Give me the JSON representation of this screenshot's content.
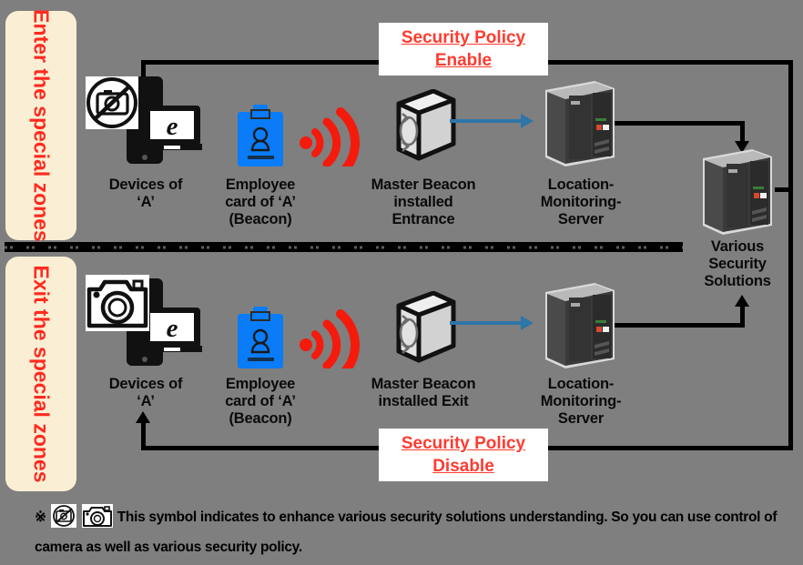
{
  "diagram": {
    "background_color": "#7f7f7f",
    "accent_red": "#ff3b30",
    "zone_box_color": "#faefd4",
    "blue_arrow_color": "#2e75a8",
    "badge_color": "#0a7cf7"
  },
  "zones": {
    "enter": {
      "label": "Enter the special zones"
    },
    "exit": {
      "label": "Exit the special zones"
    }
  },
  "policies": {
    "enable": {
      "label": "Security Policy\nEnable"
    },
    "disable": {
      "label": "Security Policy\nDisable"
    }
  },
  "top_row": {
    "devices": {
      "label": "Devices of\n‘A’",
      "icon": "no-camera-phone-laptop-icon"
    },
    "card": {
      "label": "Employee\ncard of ‘A’\n(Beacon)",
      "icon": "employee-badge-icon"
    },
    "signal": {
      "icon": "beacon-signal-icon"
    },
    "beacon": {
      "label": "Master Beacon\ninstalled\nEntrance",
      "icon": "beacon-device-icon"
    },
    "server": {
      "label": "Location-\nMonitoring-\nServer",
      "icon": "server-tower-icon"
    }
  },
  "bottom_row": {
    "devices": {
      "label": "Devices of\n‘A’",
      "icon": "camera-phone-laptop-icon"
    },
    "card": {
      "label": "Employee\ncard of ‘A’\n(Beacon)",
      "icon": "employee-badge-icon"
    },
    "signal": {
      "icon": "beacon-signal-icon"
    },
    "beacon": {
      "label": "Master Beacon\ninstalled Exit",
      "icon": "beacon-device-icon"
    },
    "server": {
      "label": "Location-\nMonitoring-\nServer",
      "icon": "server-tower-icon"
    }
  },
  "security_solutions": {
    "label": "Various\nSecurity\nSolutions",
    "icon": "server-tower-icon"
  },
  "footnote": {
    "mark": "※",
    "text": "This symbol indicates to enhance various security solutions understanding. So you can use control of camera as well as  various security policy."
  }
}
